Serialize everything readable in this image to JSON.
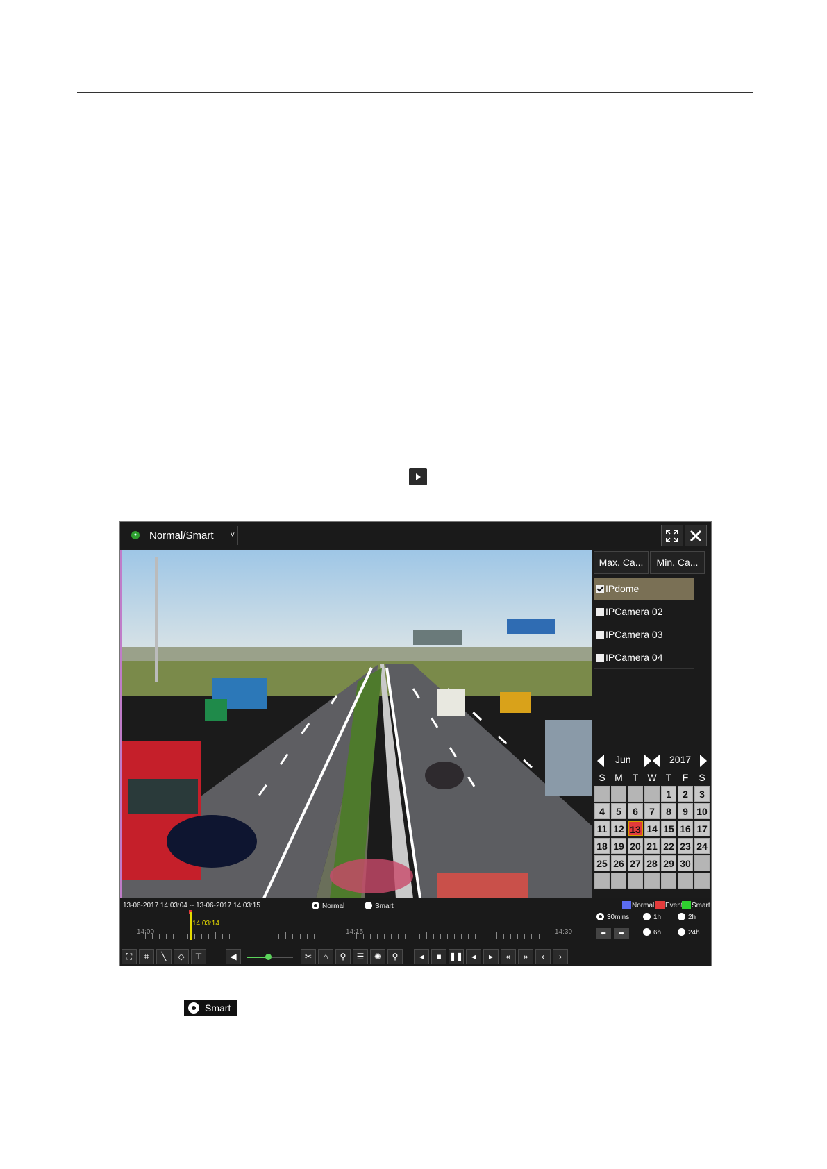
{
  "window": {
    "mode_label": "Normal/Smart",
    "scale_buttons": [
      "Max. Ca...",
      "Min. Ca..."
    ],
    "cameras": [
      {
        "label": "IPdome",
        "checked": true
      },
      {
        "label": "IPCamera 02",
        "checked": false
      },
      {
        "label": "IPCamera 03",
        "checked": false
      },
      {
        "label": "IPCamera 04",
        "checked": false
      }
    ],
    "calendar": {
      "month": "Jun",
      "year": "2017",
      "weekdays": [
        "S",
        "M",
        "T",
        "W",
        "T",
        "F",
        "S"
      ],
      "today": "13",
      "rows": [
        [
          "",
          "",
          "",
          "",
          "1",
          "2",
          "3"
        ],
        [
          "4",
          "5",
          "6",
          "7",
          "8",
          "9",
          "10"
        ],
        [
          "11",
          "12",
          "13",
          "14",
          "15",
          "16",
          "17"
        ],
        [
          "18",
          "19",
          "20",
          "21",
          "22",
          "23",
          "24"
        ],
        [
          "25",
          "26",
          "27",
          "28",
          "29",
          "30",
          ""
        ],
        [
          "",
          "",
          "",
          "",
          "",
          "",
          ""
        ]
      ]
    },
    "playback": {
      "time_range": "13-06-2017 14:03:04 -- 13-06-2017 14:03:15",
      "mode_normal": "Normal",
      "mode_smart": "Smart",
      "selected_mode": "Normal",
      "legend": [
        {
          "label": "Normal",
          "color": "#5b6cf0"
        },
        {
          "label": "Event",
          "color": "#e23b3b"
        },
        {
          "label": "Smart",
          "color": "#2fd12f"
        }
      ],
      "timeline_labels": [
        "14:00",
        "14:15",
        "14:30"
      ],
      "cursor_time": "14:03:14",
      "spans": [
        "30mins",
        "1h",
        "2h",
        "6h",
        "24h"
      ],
      "selected_span": "30mins",
      "volume_fraction": 0.45
    }
  },
  "smart_chip_label": "Smart"
}
